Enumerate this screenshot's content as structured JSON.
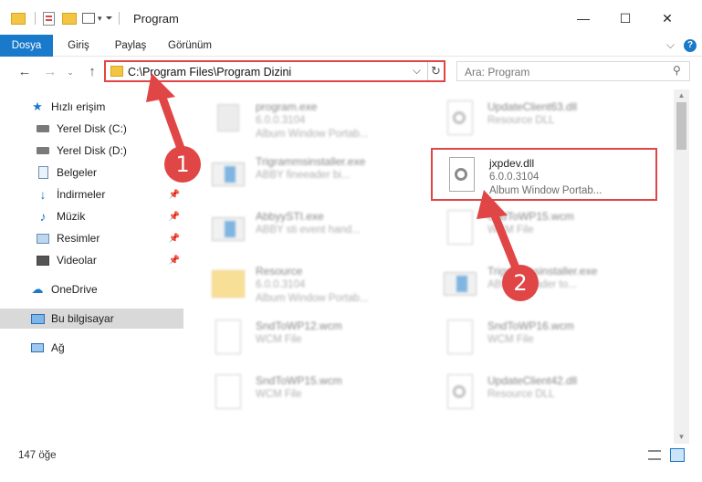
{
  "window": {
    "title": "Program",
    "minimize_glyph": "—",
    "maximize_glyph": "☐",
    "close_glyph": "✕"
  },
  "ribbon": {
    "tabs": [
      {
        "label": "Dosya",
        "active": true
      },
      {
        "label": "Giriş"
      },
      {
        "label": "Paylaş"
      },
      {
        "label": "Görünüm"
      }
    ],
    "expand_glyph": "⌵",
    "help_glyph": "?"
  },
  "address": {
    "path": "C:\\Program Files\\Program Dizini",
    "search_placeholder": "Ara: Program"
  },
  "navigation": {
    "items": [
      {
        "label": "Hızlı erişim",
        "icon": "star-icon",
        "pinned": false
      },
      {
        "label": "Yerel Disk (C:)",
        "icon": "drive-icon",
        "pinned": true
      },
      {
        "label": "Yerel Disk (D:)",
        "icon": "drive-icon",
        "pinned": true
      },
      {
        "label": "Belgeler",
        "icon": "documents-icon",
        "pinned": true
      },
      {
        "label": "İndirmeler",
        "icon": "download-icon",
        "pinned": true
      },
      {
        "label": "Müzik",
        "icon": "music-icon",
        "pinned": true
      },
      {
        "label": "Resimler",
        "icon": "pictures-icon",
        "pinned": true
      },
      {
        "label": "Videolar",
        "icon": "videos-icon",
        "pinned": true
      },
      {
        "label": "OneDrive",
        "icon": "cloud-icon",
        "pinned": false
      },
      {
        "label": "Bu bilgisayar",
        "icon": "computer-icon",
        "pinned": false,
        "selected": true
      },
      {
        "label": "Ağ",
        "icon": "network-icon",
        "pinned": false
      }
    ]
  },
  "files": [
    {
      "name": "program.exe",
      "line1": "6.0.0.3104",
      "line2": "Album Window Portab...",
      "icon": "exe-icon",
      "blurred": true
    },
    {
      "name": "UpdateClient63.dll",
      "line1": "Resource DLL",
      "line2": "",
      "icon": "dll-icon",
      "blurred": true
    },
    {
      "name": "Trigrammsinstaller.exe",
      "line1": "ABBY fineeader bi...",
      "line2": "",
      "icon": "installer-icon",
      "blurred": true
    },
    {
      "name": "jxpdev.dll",
      "line1": "6.0.0.3104",
      "line2": "Album Window Portab...",
      "icon": "dll-icon",
      "blurred": false,
      "highlighted": true
    },
    {
      "name": "AbbyySTI.exe",
      "line1": "ABBY sti event hand...",
      "line2": "",
      "icon": "installer-icon",
      "blurred": true
    },
    {
      "name": "SndToWP15.wcm",
      "line1": "WCM File",
      "line2": "",
      "icon": "file-icon",
      "blurred": true
    },
    {
      "name": "Resource",
      "line1": "6.0.0.3104",
      "line2": "Album Window Portab...",
      "icon": "folder-icon",
      "blurred": true
    },
    {
      "name": "Trigrammsinstaller.exe",
      "line1": "ABBY fineader to...",
      "line2": "",
      "icon": "installer-icon",
      "blurred": true
    },
    {
      "name": "SndToWP12.wcm",
      "line1": "WCM File",
      "line2": "",
      "icon": "file-icon",
      "blurred": true
    },
    {
      "name": "SndToWP16.wcm",
      "line1": "WCM File",
      "line2": "",
      "icon": "file-icon",
      "blurred": true
    },
    {
      "name": "SndToWP15.wcm",
      "line1": "WCM File",
      "line2": "",
      "icon": "file-icon",
      "blurred": true
    },
    {
      "name": "UpdateClient42.dll",
      "line1": "Resource DLL",
      "line2": "",
      "icon": "dll-icon",
      "blurred": true
    }
  ],
  "status": {
    "item_count": "147 öğe"
  },
  "annotations": [
    {
      "number": "1"
    },
    {
      "number": "2"
    }
  ],
  "colors": {
    "accent": "#1979ca",
    "annotation_red": "#e04646",
    "folder_yellow": "#f4c542"
  }
}
